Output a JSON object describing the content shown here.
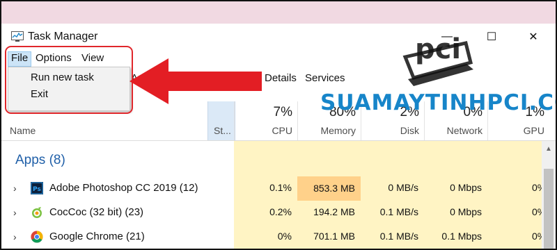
{
  "window": {
    "title": "Task Manager",
    "minimize": "—",
    "maximize": "☐",
    "close": "✕"
  },
  "menu": {
    "file": "File",
    "options": "Options",
    "view": "View"
  },
  "file_menu": {
    "items": [
      "Run new task",
      "Exit"
    ]
  },
  "tabs": {
    "app_history": "App his",
    "details": "Details",
    "services": "Services"
  },
  "columns": {
    "name": "Name",
    "status": "St...",
    "cpu": {
      "pct": "7%",
      "label": "CPU"
    },
    "memory": {
      "pct": "80%",
      "label": "Memory"
    },
    "disk": {
      "pct": "2%",
      "label": "Disk"
    },
    "network": {
      "pct": "0%",
      "label": "Network"
    },
    "gpu": {
      "pct": "1%",
      "label": "GPU"
    }
  },
  "group": {
    "title": "Apps (8)"
  },
  "processes": [
    {
      "name": "Adobe Photoshop CC 2019 (12)",
      "cpu": "0.1%",
      "memory": "853.3 MB",
      "disk": "0 MB/s",
      "network": "0 Mbps",
      "gpu": "0%",
      "icon": "photoshop-icon"
    },
    {
      "name": "CocCoc (32 bit) (23)",
      "cpu": "0.2%",
      "memory": "194.2 MB",
      "disk": "0.1 MB/s",
      "network": "0 Mbps",
      "gpu": "0%",
      "icon": "coccoc-icon"
    },
    {
      "name": "Google Chrome (21)",
      "cpu": "0%",
      "memory": "701.1 MB",
      "disk": "0.1 MB/s",
      "network": "0.1 Mbps",
      "gpu": "0%",
      "icon": "chrome-icon"
    }
  ],
  "icons": {
    "ps_text": "Ps"
  },
  "watermark": {
    "logo": "pci",
    "text": "SUAMAYTINHPCI.COM"
  },
  "colors": {
    "highlight_red": "#e0262b",
    "accent_blue": "#1f5fa8",
    "heat_light": "#fff4c4",
    "heat_memory": "#ffd18a"
  }
}
